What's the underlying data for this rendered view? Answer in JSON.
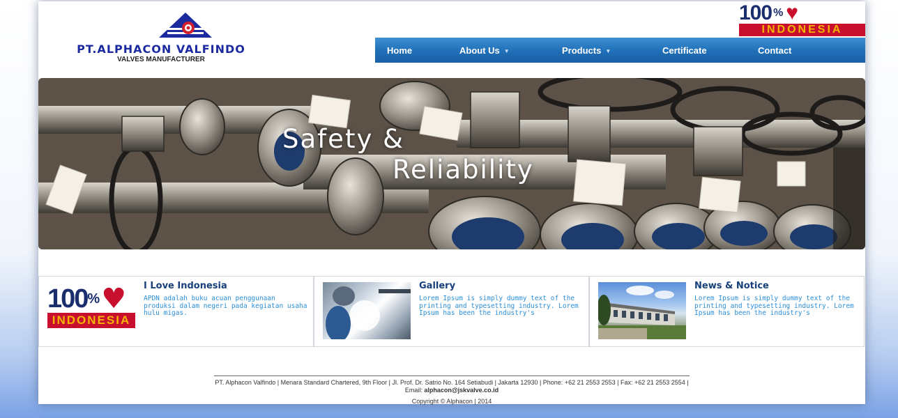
{
  "header": {
    "company_name": "PT.ALPHACON VALFINDO",
    "tagline": "VALVES MANUFACTURER",
    "logo_icon": "triangle-valve-logo-icon",
    "badge": {
      "number": "100",
      "percent": "%",
      "word": "INDONESIA",
      "heart_icon": "heart-icon"
    }
  },
  "nav": {
    "items": [
      {
        "label": "Home",
        "dropdown": false
      },
      {
        "label": "About Us",
        "dropdown": true
      },
      {
        "label": "Products",
        "dropdown": true
      },
      {
        "label": "Certificate",
        "dropdown": false
      },
      {
        "label": "Contact",
        "dropdown": false
      }
    ],
    "caret": "▼"
  },
  "banner": {
    "line1": "Safety &",
    "line2": "Reliability"
  },
  "boxes": [
    {
      "title": "I Love Indonesia",
      "text": "APDN adalah buku acuan penggunaan produksi dalam negeri pada kegiatan usaha hulu migas.",
      "image": "100-percent-indonesia-badge"
    },
    {
      "title": "Gallery",
      "text": "Lorem Ipsum is simply dummy text of the printing and typesetting industry. Lorem Ipsum has been the industry's",
      "image": "welding-worker-photo"
    },
    {
      "title": "News & Notice",
      "text": "Lorem Ipsum is simply dummy text of the printing and typesetting industry. Lorem Ipsum has been the industry's",
      "image": "factory-building-photo"
    }
  ],
  "footer": {
    "address": "PT. Alphacon Valfindo | Menara Standard Chartered, 9th Floor | Jl. Prof. Dr. Satrio No. 164 Setiabudi | Jakarta 12930 | Phone: +62 21 2553 2553 | Fax: +62 21 2553 2554 |",
    "email_label": "Email:",
    "email": "alphacon@jskvalve.co.id",
    "copyright": "Copyright © Alphacon | 2014"
  },
  "colors": {
    "nav_blue": "#1f6fb8",
    "title_navy": "#17407a",
    "text_blue": "#2b8ed8",
    "logo_blue": "#1c2aa0",
    "badge_red": "#c8102e"
  }
}
